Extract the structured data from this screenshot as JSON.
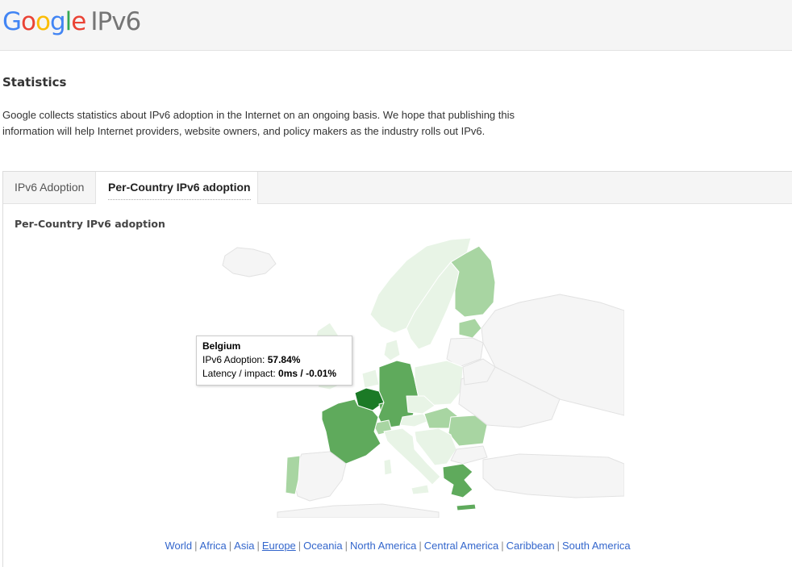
{
  "header": {
    "logo_letters": [
      "G",
      "o",
      "o",
      "g",
      "l",
      "e"
    ],
    "product": "IPv6"
  },
  "page": {
    "title": "Statistics",
    "intro_line1": "Google collects statistics about IPv6 adoption in the Internet on an ongoing basis. We hope that publishing this",
    "intro_line2": "information will help Internet providers, website owners, and policy makers as the industry rolls out IPv6."
  },
  "tabs": [
    {
      "label": "IPv6 Adoption",
      "active": false
    },
    {
      "label": "Per-Country IPv6 adoption",
      "active": true
    }
  ],
  "section": {
    "subtitle": "Per-Country IPv6 adoption"
  },
  "tooltip": {
    "country": "Belgium",
    "adoption_label": "IPv6 Adoption: ",
    "adoption_value": "57.84%",
    "latency_label": "Latency / impact: ",
    "latency_value": "0ms / -0.01%"
  },
  "regions": {
    "items": [
      "World",
      "Africa",
      "Asia",
      "Europe",
      "Oceania",
      "North America",
      "Central America",
      "Caribbean",
      "South America"
    ],
    "selected": "Europe"
  },
  "colors": {
    "low": "#e8f4e6",
    "mid": "#a8d5a2",
    "high": "#5faa5c",
    "highest": "#1b7a26",
    "none": "#f5f5f5"
  }
}
